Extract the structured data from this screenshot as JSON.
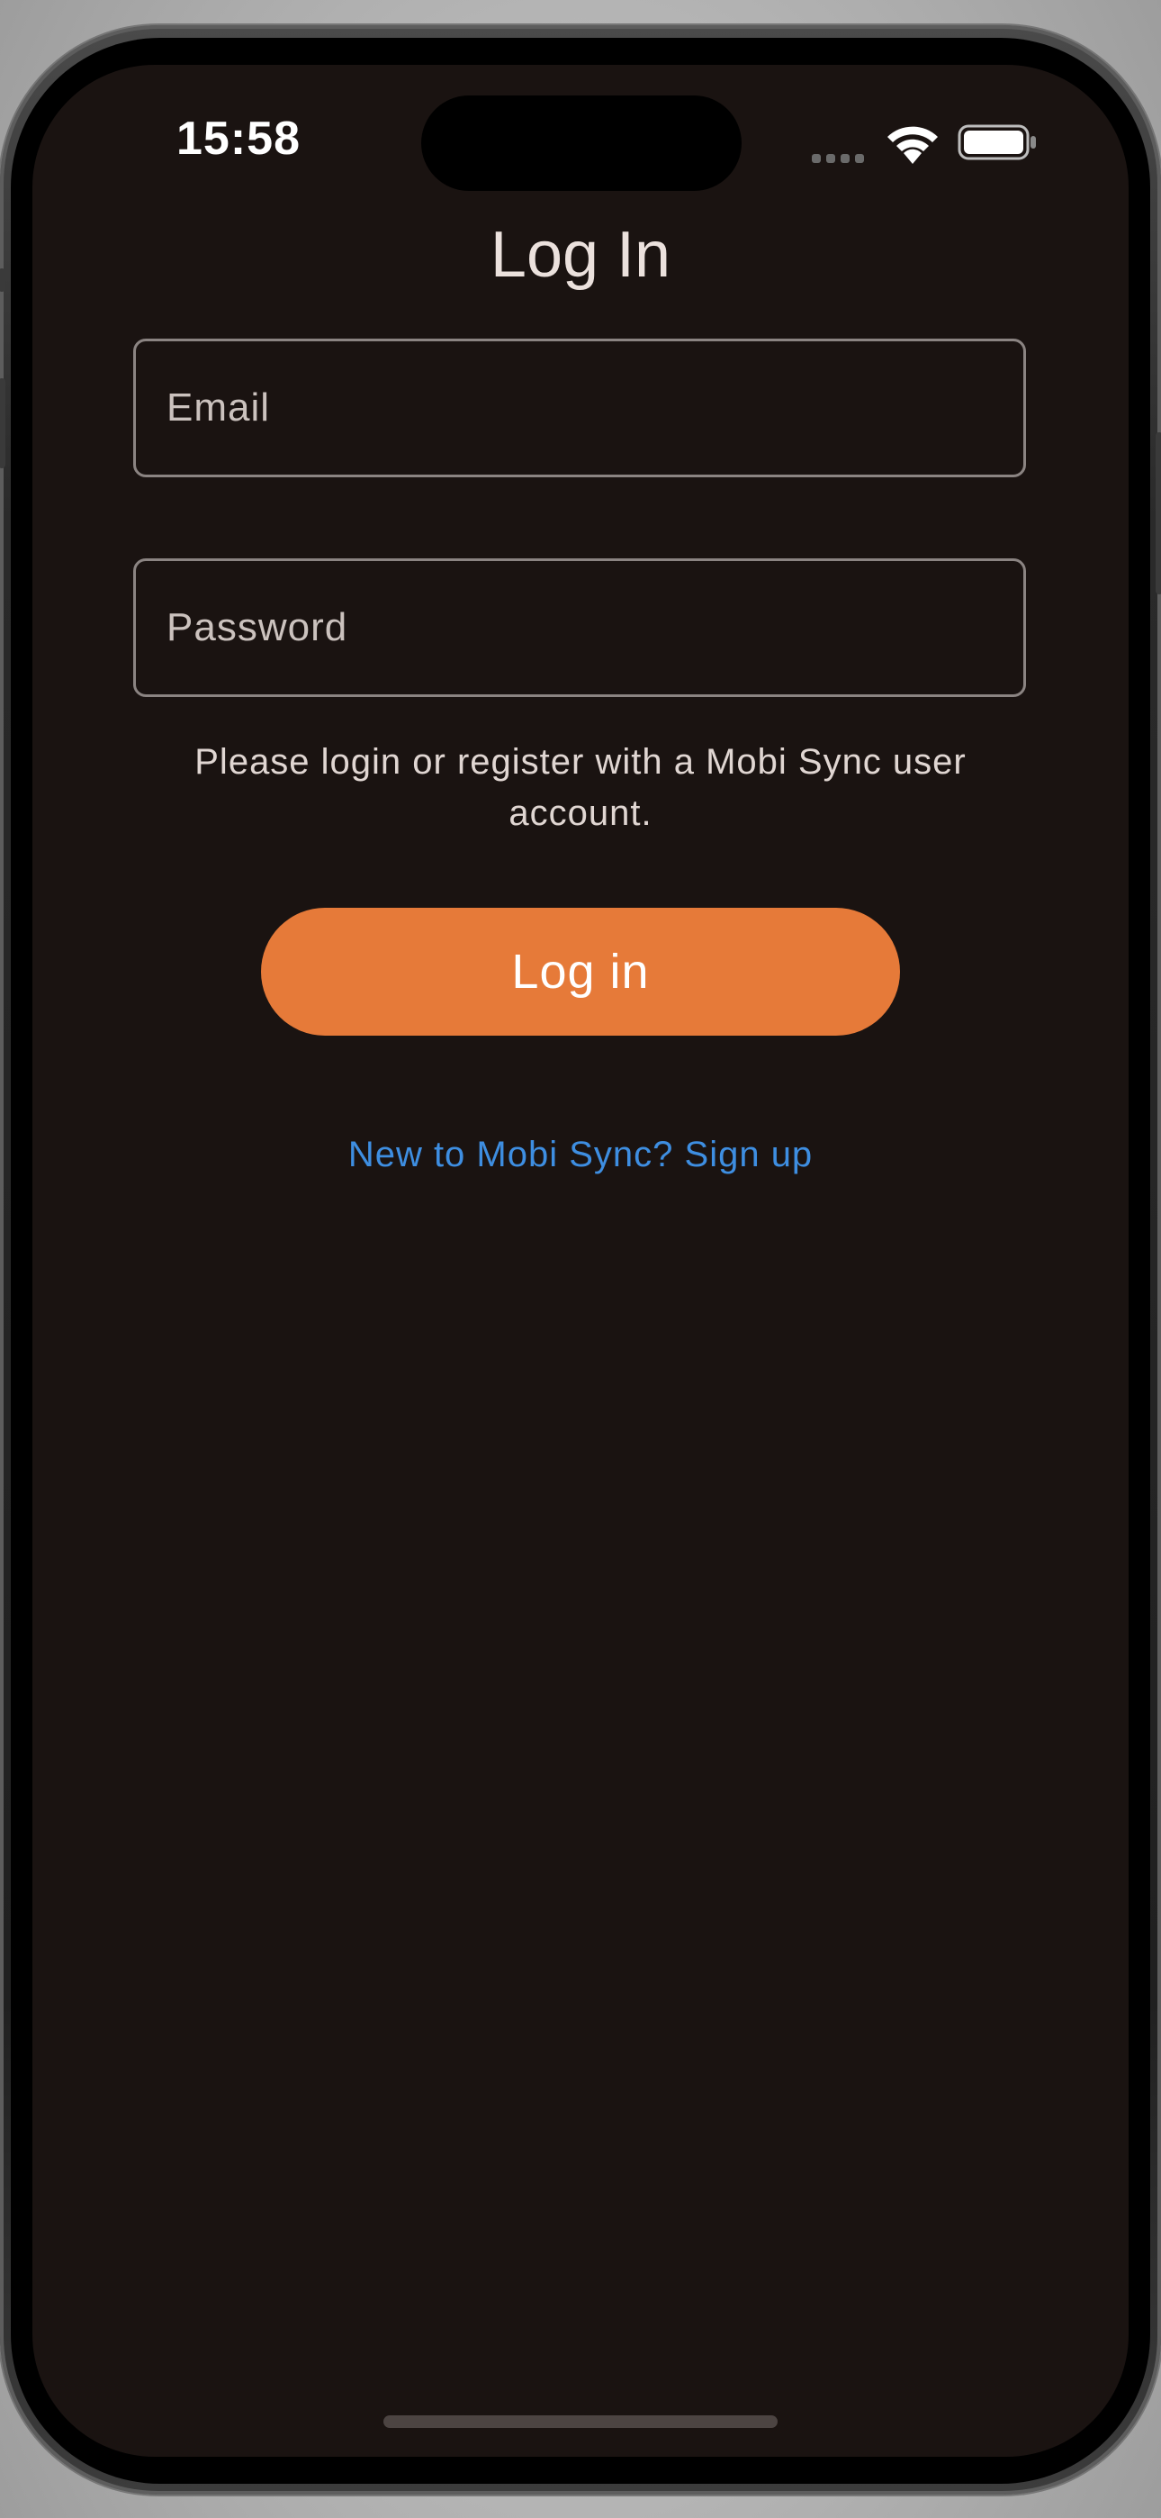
{
  "status_bar": {
    "time": "15:58",
    "signal_icon": "cellular-signal-icon",
    "wifi_icon": "wifi-icon",
    "battery_icon": "battery-icon"
  },
  "login": {
    "title": "Log In",
    "email_placeholder": "Email",
    "password_placeholder": "Password",
    "hint": "Please login or register with a Mobi Sync user account.",
    "login_button": "Log in",
    "signup_link": "New to Mobi Sync? Sign up"
  },
  "colors": {
    "background": "#1a1311",
    "accent": "#e67a39",
    "link": "#3e8ee1",
    "text": "#ebe1dd",
    "field_border": "#8b8482"
  }
}
